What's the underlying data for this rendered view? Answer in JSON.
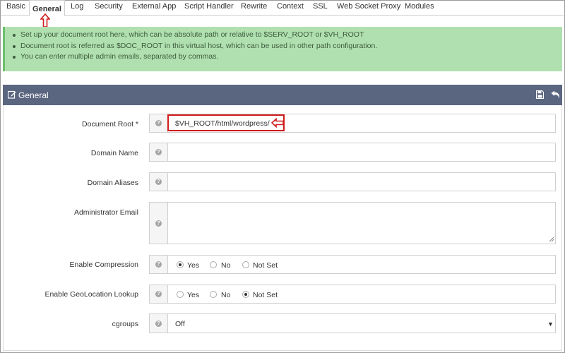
{
  "tabs": [
    "Basic",
    "General",
    "Log",
    "Security",
    "External App",
    "Script Handler",
    "Rewrite",
    "Context",
    "SSL",
    "Web Socket Proxy",
    "Modules"
  ],
  "active_tab": "General",
  "alert": [
    "Set up your document root here, which can be absolute path or relative to $SERV_ROOT or $VH_ROOT",
    "Document root is referred as $DOC_ROOT in this virtual host, which can be used in other path configuration.",
    "You can enter multiple admin emails, separated by commas."
  ],
  "panel": {
    "title": "General",
    "icons": [
      "edit-icon",
      "save-icon",
      "undo-icon"
    ]
  },
  "fields": {
    "document_root": {
      "label": "Document Root *",
      "value": "$VH_ROOT/html/wordpress/"
    },
    "domain_name": {
      "label": "Domain Name",
      "value": ""
    },
    "domain_aliases": {
      "label": "Domain Aliases",
      "value": ""
    },
    "admin_email": {
      "label": "Administrator Email",
      "value": ""
    },
    "enable_compression": {
      "label": "Enable Compression",
      "options": [
        "Yes",
        "No",
        "Not Set"
      ],
      "selected": "Yes"
    },
    "geolocation_lookup": {
      "label": "Enable GeoLocation Lookup",
      "options": [
        "Yes",
        "No",
        "Not Set"
      ],
      "selected": "Not Set"
    },
    "cgroups": {
      "label": "cgroups",
      "value": "Off"
    }
  },
  "help_glyph": "?",
  "colors": {
    "alert_bg": "#b0e0b0",
    "panel_header": "#5a6580",
    "annotation": "#d01c1c"
  }
}
